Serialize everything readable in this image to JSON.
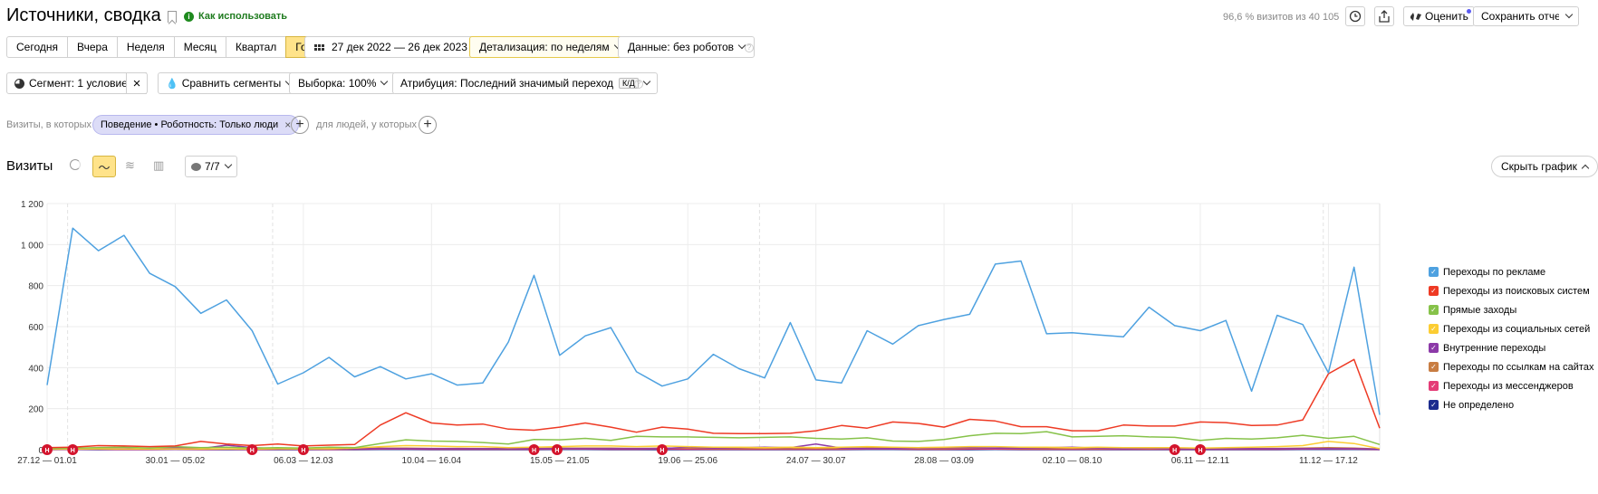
{
  "header": {
    "title": "Источники, сводка",
    "howto": "Как использовать",
    "visits_note": "96,6 % визитов из 40 105",
    "rate": "Оценить",
    "save": "Сохранить отчет"
  },
  "period": {
    "items": [
      "Сегодня",
      "Вчера",
      "Неделя",
      "Месяц",
      "Квартал",
      "Год"
    ],
    "active": "Год",
    "range": "27 дек 2022 — 26 дек 2023",
    "detail": "Детализация: по неделям",
    "robots": "Данные: без роботов"
  },
  "segments": {
    "segment": "Сегмент: 1 условие",
    "compare": "Сравнить сегменты",
    "sample": "Выборка: 100%",
    "attribution": "Атрибуция: Последний значимый переход",
    "attribution_kbd": "К/Д"
  },
  "filter": {
    "visits_which": "Визиты, в которых",
    "chip": "Поведение • Роботность: Только люди",
    "people_which": "для людей, у которых"
  },
  "chart_header": {
    "title": "Визиты",
    "notes": "7/7",
    "hide": "Скрыть график"
  },
  "chart_data": {
    "type": "line",
    "ylim": [
      0,
      1200
    ],
    "yticks": [
      "0",
      "200",
      "400",
      "600",
      "800",
      "1 000",
      "1 200"
    ],
    "xtick_labels": [
      "27.12 — 01.01",
      "30.01 — 05.02",
      "06.03 — 12.03",
      "10.04 — 16.04",
      "15.05 — 21.05",
      "19.06 — 25.06",
      "24.07 — 30.07",
      "28.08 — 03.09",
      "02.10 — 08.10",
      "06.11 — 12.11",
      "11.12 — 17.12"
    ],
    "xtick_index": [
      0,
      5,
      10,
      15,
      20,
      25,
      30,
      35,
      40,
      45,
      50
    ],
    "note_marker_label": "Н",
    "note_marker_index": [
      0,
      1,
      8,
      10,
      19,
      19.9,
      24,
      44,
      45
    ],
    "series": [
      {
        "name": "Переходы по рекламе",
        "color": "#4ea1e0",
        "values": [
          315,
          1080,
          970,
          1045,
          860,
          795,
          665,
          730,
          580,
          320,
          375,
          450,
          355,
          405,
          345,
          370,
          315,
          325,
          525,
          850,
          460,
          555,
          595,
          380,
          310,
          345,
          465,
          395,
          350,
          620,
          340,
          325,
          580,
          515,
          605,
          635,
          660,
          905,
          920,
          565,
          570,
          560,
          550,
          695,
          605,
          580,
          630,
          285,
          655,
          610,
          375,
          890,
          170
        ]
      },
      {
        "name": "Переходы из поисковых систем",
        "color": "#ee3a24",
        "values": [
          10,
          12,
          20,
          18,
          15,
          18,
          40,
          28,
          20,
          28,
          18,
          22,
          25,
          120,
          180,
          130,
          120,
          125,
          100,
          95,
          110,
          130,
          110,
          85,
          110,
          100,
          80,
          78,
          78,
          80,
          92,
          118,
          105,
          135,
          128,
          110,
          148,
          140,
          112,
          112,
          92,
          92,
          120,
          115,
          115,
          135,
          132,
          118,
          120,
          145,
          370,
          440,
          105
        ]
      },
      {
        "name": "Прямые заходы",
        "color": "#86c249",
        "values": [
          5,
          8,
          10,
          12,
          8,
          15,
          10,
          12,
          8,
          10,
          8,
          12,
          10,
          30,
          48,
          42,
          40,
          35,
          28,
          50,
          48,
          55,
          45,
          65,
          62,
          62,
          60,
          58,
          60,
          62,
          55,
          52,
          58,
          42,
          40,
          50,
          68,
          80,
          78,
          88,
          62,
          65,
          68,
          62,
          60,
          45,
          55,
          52,
          58,
          70,
          55,
          65,
          25
        ]
      },
      {
        "name": "Переходы из социальных сетей",
        "color": "#fccd33",
        "values": [
          2,
          3,
          4,
          3,
          3,
          4,
          3,
          4,
          3,
          5,
          4,
          5,
          8,
          15,
          20,
          18,
          15,
          15,
          10,
          12,
          15,
          18,
          18,
          15,
          18,
          15,
          12,
          12,
          10,
          12,
          10,
          12,
          15,
          12,
          10,
          12,
          15,
          15,
          12,
          12,
          10,
          12,
          10,
          10,
          10,
          8,
          10,
          12,
          15,
          20,
          40,
          30,
          5
        ]
      },
      {
        "name": "Внутренние переходы",
        "color": "#8c3aa8",
        "values": [
          2,
          8,
          5,
          5,
          8,
          10,
          5,
          22,
          10,
          5,
          5,
          5,
          5,
          5,
          5,
          5,
          5,
          5,
          5,
          5,
          5,
          5,
          5,
          5,
          5,
          12,
          8,
          10,
          12,
          10,
          28,
          8,
          5,
          5,
          8,
          10,
          10,
          8,
          8,
          10,
          12,
          8,
          5,
          8,
          5,
          5,
          5,
          5,
          5,
          5,
          5,
          5,
          2
        ]
      },
      {
        "name": "Переходы по ссылкам на сайтах",
        "color": "#c87d43",
        "values": [
          3,
          5,
          4,
          3,
          3,
          4,
          3,
          4,
          3,
          5,
          4,
          3,
          5,
          8,
          8,
          6,
          6,
          5,
          5,
          6,
          8,
          8,
          8,
          6,
          8,
          8,
          6,
          6,
          6,
          6,
          6,
          6,
          8,
          8,
          6,
          6,
          8,
          8,
          6,
          6,
          6,
          6,
          6,
          6,
          6,
          6,
          6,
          6,
          6,
          8,
          10,
          8,
          3
        ]
      },
      {
        "name": "Переходы из мессенджеров",
        "color": "#e43c77",
        "values": [
          1,
          2,
          2,
          1,
          1,
          2,
          1,
          2,
          1,
          2,
          2,
          1,
          2,
          3,
          3,
          2,
          2,
          2,
          2,
          2,
          3,
          3,
          2,
          2,
          3,
          2,
          2,
          2,
          2,
          2,
          2,
          2,
          3,
          3,
          2,
          2,
          3,
          3,
          2,
          2,
          2,
          2,
          2,
          2,
          2,
          2,
          2,
          2,
          2,
          3,
          4,
          3,
          1
        ]
      },
      {
        "name": "Не определено",
        "color": "#1c2c8e",
        "values": [
          0,
          1,
          0,
          0,
          0,
          1,
          0,
          0,
          0,
          0,
          0,
          0,
          0,
          1,
          1,
          0,
          0,
          0,
          0,
          0,
          1,
          1,
          0,
          0,
          0,
          0,
          0,
          0,
          0,
          0,
          0,
          0,
          1,
          1,
          0,
          0,
          0,
          1,
          0,
          0,
          0,
          0,
          0,
          0,
          0,
          0,
          0,
          0,
          0,
          1,
          1,
          1,
          0
        ]
      }
    ]
  }
}
